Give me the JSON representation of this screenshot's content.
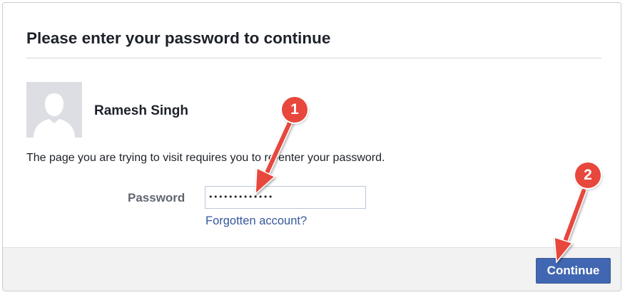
{
  "dialog": {
    "title": "Please enter your password to continue",
    "user": {
      "name": "Ramesh Singh",
      "avatar_icon": "default-profile-silhouette-icon"
    },
    "message": "The page you are trying to visit requires you to re-enter your password.",
    "password": {
      "label": "Password",
      "value": "•••••••••••••"
    },
    "forgot_link": "Forgotten account?",
    "continue_label": "Continue"
  },
  "annotations": {
    "marker_1": "1",
    "marker_2": "2",
    "color": "#e8473d"
  },
  "colors": {
    "primary_button": "#4267b2",
    "link": "#365899",
    "footer_bg": "#f2f2f2"
  }
}
